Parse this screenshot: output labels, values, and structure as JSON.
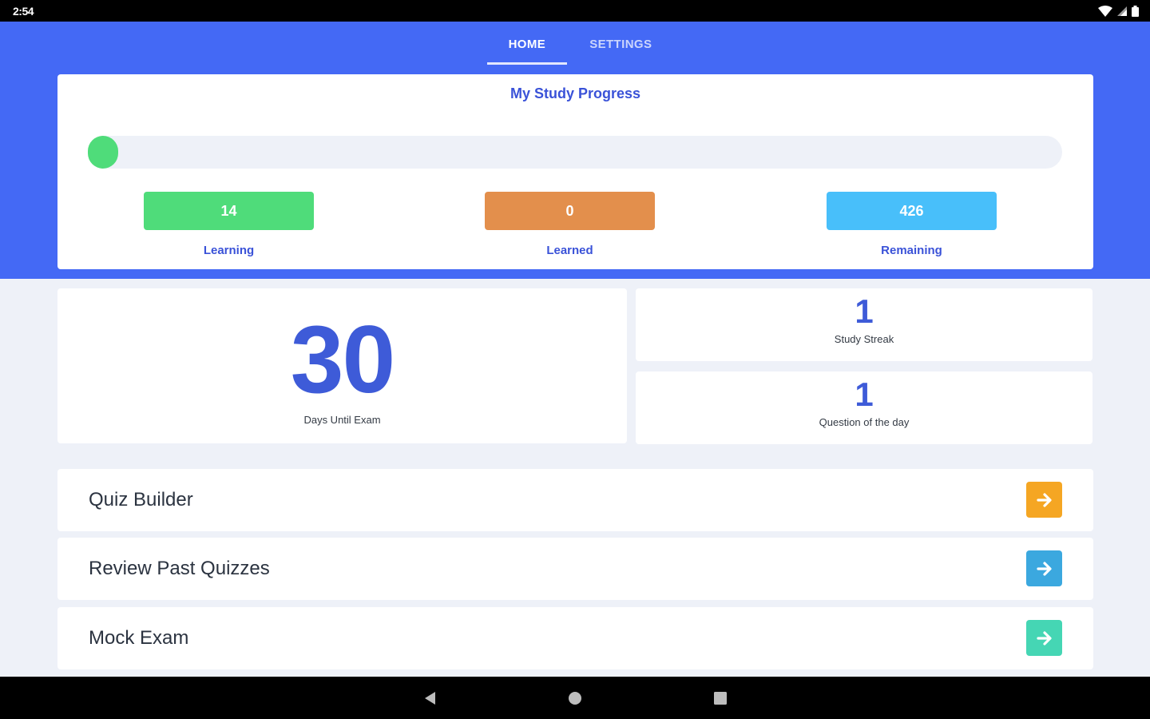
{
  "status_bar": {
    "time": "2:54"
  },
  "tabs": [
    {
      "label": "HOME",
      "active": true
    },
    {
      "label": "SETTINGS",
      "active": false
    }
  ],
  "progress": {
    "title": "My Study Progress",
    "fraction": 0.0,
    "stats": [
      {
        "value": "14",
        "label": "Learning",
        "color": "#4fdc7a"
      },
      {
        "value": "0",
        "label": "Learned",
        "color": "#e38f4c"
      },
      {
        "value": "426",
        "label": "Remaining",
        "color": "#48bffa"
      }
    ]
  },
  "days_until_exam": {
    "value": "30",
    "label": "Days Until Exam"
  },
  "study_streak": {
    "value": "1",
    "label": "Study Streak"
  },
  "question_of_day": {
    "value": "1",
    "label": "Question of the day"
  },
  "actions": [
    {
      "label": "Quiz Builder",
      "color": "#f5a623"
    },
    {
      "label": "Review Past Quizzes",
      "color": "#3ba8df"
    },
    {
      "label": "Mock Exam",
      "color": "#45d6b4"
    }
  ],
  "colors": {
    "header": "#4469f5",
    "accent": "#3e5bd8",
    "background": "#eef1f8"
  },
  "icons": {
    "status": [
      "wifi-icon",
      "signal-icon",
      "battery-icon"
    ],
    "nav": [
      "back-icon",
      "home-icon",
      "recents-icon"
    ],
    "action": "arrow-right-icon"
  }
}
